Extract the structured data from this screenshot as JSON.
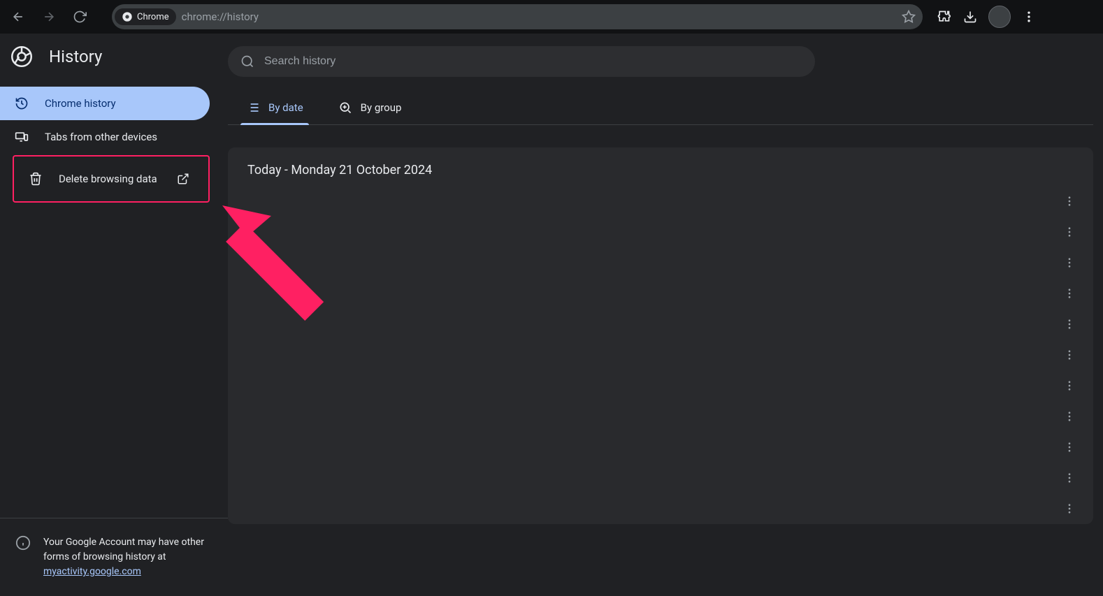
{
  "browser": {
    "site_name": "Chrome",
    "url": "chrome://history"
  },
  "header": {
    "title": "History"
  },
  "search": {
    "placeholder": "Search history"
  },
  "sidebar": {
    "items": [
      {
        "label": "Chrome history"
      },
      {
        "label": "Tabs from other devices"
      },
      {
        "label": "Delete browsing data"
      }
    ],
    "footer_text": "Your Google Account may have other forms of browsing history at ",
    "footer_link": "myactivity.google.com"
  },
  "tabs": [
    {
      "label": "By date"
    },
    {
      "label": "By group"
    }
  ],
  "content": {
    "date_header": "Today - Monday 21 October 2024",
    "row_count": 11
  }
}
